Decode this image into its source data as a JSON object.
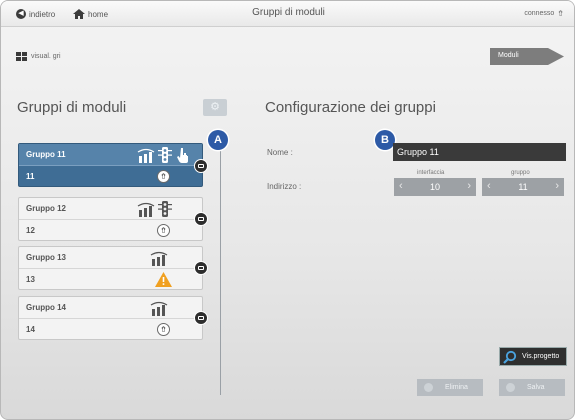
{
  "topbar": {
    "back_label": "indietro",
    "home_label": "home",
    "title": "Gruppi di moduli",
    "status": "connesso"
  },
  "subbar": {
    "view_label": "visual. gri",
    "moduli_label": "Moduli"
  },
  "left_panel": {
    "title": "Gruppi di moduli",
    "groups": [
      {
        "name": "Gruppo 11",
        "address": "11",
        "icons": [
          "sensor-icon",
          "traffic-light-icon",
          "hand-icon"
        ],
        "status_icon": "usb-icon",
        "selected": true
      },
      {
        "name": "Gruppo 12",
        "address": "12",
        "icons": [
          "sensor-icon",
          "traffic-light-icon"
        ],
        "status_icon": "usb-icon",
        "selected": false
      },
      {
        "name": "Gruppo 13",
        "address": "13",
        "icons": [
          "sensor-icon"
        ],
        "status_icon": "warning-icon",
        "selected": false
      },
      {
        "name": "Gruppo 14",
        "address": "14",
        "icons": [
          "sensor-icon"
        ],
        "status_icon": "usb-icon",
        "selected": false
      }
    ]
  },
  "right_panel": {
    "title": "Configurazione dei gruppi",
    "name_label": "Nome :",
    "name_value": "Gruppo 11",
    "address_label": "Indirizzo :",
    "interface_label": "interfaccia",
    "interface_value": "10",
    "group_label": "gruppo",
    "group_value": "11",
    "vis_button": "Vis.progetto",
    "delete_button": "Elimina",
    "save_button": "Salva"
  },
  "callouts": {
    "a": "A",
    "b": "B"
  },
  "colors": {
    "accent": "#2d5aa6",
    "selected": "#3f6d95",
    "warning": "#f0a020"
  }
}
